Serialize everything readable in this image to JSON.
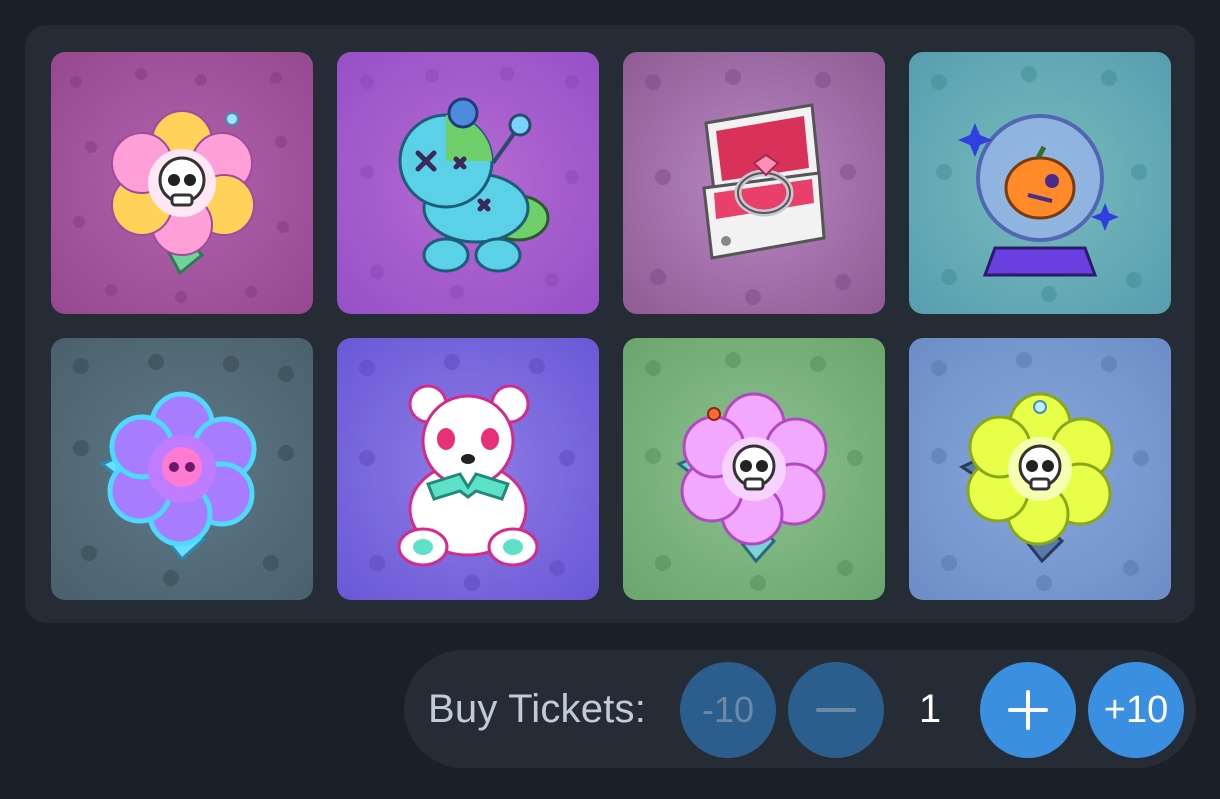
{
  "items": [
    {
      "id": "item-1",
      "name": "skull-flower-pink-icon"
    },
    {
      "id": "item-2",
      "name": "voodoo-doll-icon"
    },
    {
      "id": "item-3",
      "name": "ring-box-icon"
    },
    {
      "id": "item-4",
      "name": "pumpkin-crystal-ball-icon"
    },
    {
      "id": "item-5",
      "name": "skull-flower-cyan-icon"
    },
    {
      "id": "item-6",
      "name": "teddy-bear-icon"
    },
    {
      "id": "item-7",
      "name": "skull-flower-lilac-icon"
    },
    {
      "id": "item-8",
      "name": "skull-flower-yellow-icon"
    }
  ],
  "buy": {
    "label": "Buy Tickets:",
    "minus10_label": "-10",
    "minus_icon": "minus-icon",
    "quantity": "1",
    "plus_icon": "plus-icon",
    "plus10_label": "+10"
  },
  "colors": {
    "page_bg": "#1b2027",
    "panel_bg": "#252c36",
    "button_disabled": "#2c5e8d",
    "button_active": "#3a8fe0"
  }
}
